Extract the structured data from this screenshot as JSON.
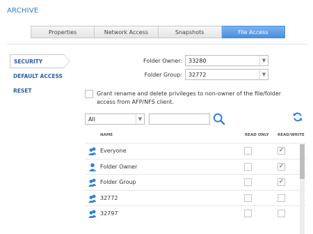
{
  "page": {
    "title": "ARCHIVE"
  },
  "tabs": [
    {
      "label": "Properties"
    },
    {
      "label": "Network Access"
    },
    {
      "label": "Snapshots"
    },
    {
      "label": "File Access",
      "active": true
    }
  ],
  "sidebar": {
    "items": [
      {
        "label": "SECURITY",
        "active": true
      },
      {
        "label": "DEFAULT ACCESS"
      },
      {
        "label": "RESET"
      }
    ]
  },
  "form": {
    "folder_owner_label": "Folder Owner:",
    "folder_owner_value": "33280",
    "folder_group_label": "Folder Group:",
    "folder_group_value": "32772"
  },
  "grant": {
    "text": "Grant rename and delete privileges to non-owner of the file/folder access from AFP/NFS client.",
    "checked": false
  },
  "filter": {
    "selected": "All",
    "search_value": ""
  },
  "table": {
    "columns": {
      "name": "NAME",
      "read_only": "READ ONLY",
      "read_write": "READ/WRITE"
    },
    "rows": [
      {
        "name": "Everyone",
        "icon": "group-icon",
        "read_only": false,
        "read_write": true
      },
      {
        "name": "Folder Owner",
        "icon": "user-icon",
        "read_only": false,
        "read_write": true
      },
      {
        "name": "Folder Group",
        "icon": "group-icon",
        "read_only": false,
        "read_write": true
      },
      {
        "name": "32772",
        "icon": "group-icon",
        "read_only": false,
        "read_write": false
      },
      {
        "name": "32797",
        "icon": "group-icon",
        "read_only": false,
        "read_write": false
      }
    ]
  },
  "colors": {
    "accent": "#3a77c8",
    "active_tab": "#4a8ee0",
    "icon_blue": "#2f7fd8"
  }
}
